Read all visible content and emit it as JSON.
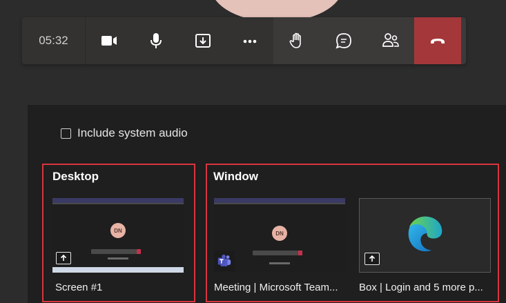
{
  "toolbar": {
    "timer": "05:32",
    "buttons": [
      {
        "name": "camera",
        "icon": "video-camera-icon"
      },
      {
        "name": "mic",
        "icon": "microphone-icon"
      },
      {
        "name": "share",
        "icon": "share-tray-icon"
      },
      {
        "name": "more",
        "icon": "more-dots-icon"
      },
      {
        "name": "raise-hand",
        "icon": "hand-icon"
      },
      {
        "name": "chat",
        "icon": "chat-bubble-icon"
      },
      {
        "name": "participants",
        "icon": "people-icon"
      },
      {
        "name": "hang-up",
        "icon": "phone-hangup-icon"
      }
    ],
    "hangup_color": "#a4373a"
  },
  "share": {
    "include_audio_label": "Include system audio",
    "include_audio_checked": false,
    "desktop": {
      "title": "Desktop",
      "screens": [
        {
          "caption": "Screen #1",
          "avatar": "DN"
        }
      ]
    },
    "window": {
      "title": "Window",
      "windows": [
        {
          "caption": "Meeting | Microsoft Team...",
          "avatar": "DN",
          "app_icon": "teams-icon"
        },
        {
          "caption": "Box | Login and 5 more p...",
          "app_icon": "edge-browser-icon"
        }
      ]
    }
  },
  "colors": {
    "highlight_border": "#d9353f",
    "panel_bg": "#1f1f1f",
    "toolbar_bg": "#3b3a39"
  }
}
